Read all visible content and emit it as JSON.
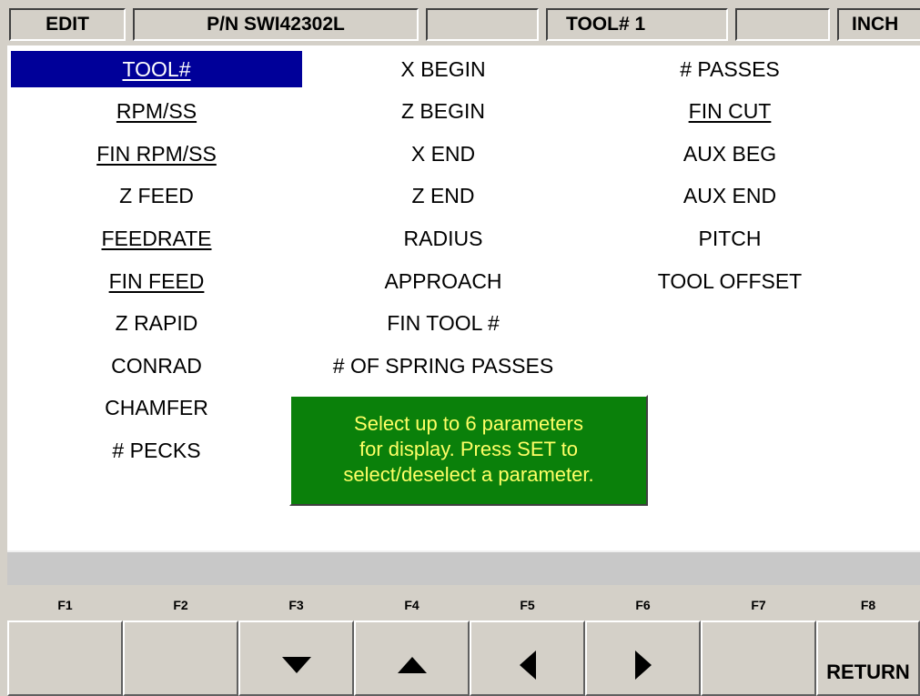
{
  "status_bar": {
    "mode": "EDIT",
    "part_number": "P/N SWI42302L",
    "field3": "",
    "tool": "TOOL# 1",
    "field5": "",
    "units": "INCH"
  },
  "parameters": {
    "col1": [
      "TOOL#",
      "RPM/SS",
      "FIN RPM/SS",
      "Z FEED",
      "FEEDRATE",
      "FIN FEED",
      "Z RAPID",
      "CONRAD",
      "CHAMFER",
      "# PECKS"
    ],
    "col2": [
      "X BEGIN",
      "Z BEGIN",
      "X END",
      "Z END",
      "RADIUS",
      "APPROACH",
      "FIN TOOL #",
      "# OF SPRING PASSES"
    ],
    "col3": [
      "# PASSES",
      "FIN CUT",
      "AUX BEG",
      "AUX END",
      "PITCH",
      "TOOL OFFSET"
    ],
    "selected_for_display": [
      "TOOL#",
      "RPM/SS",
      "FIN RPM/SS",
      "FEEDRATE",
      "FIN FEED",
      "FIN CUT"
    ],
    "highlighted": "TOOL#"
  },
  "hint": {
    "line1": "Select up to 6 parameters",
    "line2": "for display.  Press SET to",
    "line3": "select/deselect a parameter."
  },
  "message": "",
  "function_keys": [
    {
      "label": "F1",
      "text": "",
      "icon": ""
    },
    {
      "label": "F2",
      "text": "",
      "icon": ""
    },
    {
      "label": "F3",
      "text": "",
      "icon": "arrow-down-icon"
    },
    {
      "label": "F4",
      "text": "",
      "icon": "arrow-up-icon"
    },
    {
      "label": "F5",
      "text": "",
      "icon": "arrow-left-icon"
    },
    {
      "label": "F6",
      "text": "",
      "icon": "arrow-right-icon"
    },
    {
      "label": "F7",
      "text": "",
      "icon": ""
    },
    {
      "label": "F8",
      "text": "RETURN",
      "icon": ""
    }
  ],
  "colors": {
    "selection": "#000099",
    "hint_background": "#0a800a",
    "hint_text": "#ffff66",
    "panel": "#ffffff",
    "chrome": "#d4d0c8"
  }
}
